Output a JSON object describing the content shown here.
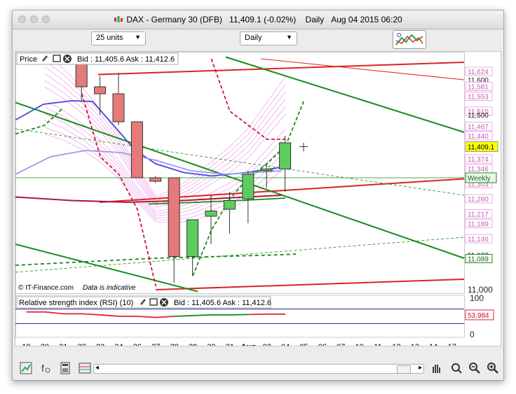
{
  "window": {
    "title": "DAX - Germany 30 (DFB)",
    "last": "11,409.1 (-0.02%)",
    "period": "Daily",
    "datetime": "Aug 04 2015 06:20"
  },
  "toolbar": {
    "units_select": "25 units",
    "timeframe_select": "Daily"
  },
  "price_panel": {
    "label": "Price",
    "bid_ask": "Bid : 11,405.6  Ask : 11,412.6",
    "watermark": "© IT-Finance.com",
    "disclaimer": "Data is indicative",
    "current_price": "11,409.1",
    "weekly_tag": "Weekly",
    "axis_labels": [
      "11,624",
      "11,600",
      "11,581",
      "11,553",
      "11,510",
      "11,500",
      "11,467",
      "11,440",
      "11,374",
      "11,346",
      "11,303",
      "11,260",
      "11,217",
      "11,189",
      "11,146",
      "11,100",
      "11,089",
      "11,000"
    ],
    "green_axis_label": "11,089"
  },
  "rsi_panel": {
    "label": "Relative strength index (RSI) (10)",
    "bid_ask": "Bid : 11,405.6  Ask : 11,412.6",
    "axis_top": "100",
    "axis_bottom": "0",
    "value": "53.984"
  },
  "xaxis": {
    "labels": [
      "19",
      "20",
      "21",
      "22",
      "23",
      "24",
      "26",
      "27",
      "28",
      "29",
      "30",
      "31",
      "Aug",
      "03",
      "04",
      "05",
      "06",
      "07",
      "10",
      "11",
      "12",
      "13",
      "14",
      "17"
    ]
  },
  "chart_data": {
    "type": "candlestick",
    "instrument": "DAX - Germany 30 (DFB)",
    "dates": [
      "21",
      "22",
      "23",
      "24",
      "26",
      "27",
      "28",
      "29",
      "30",
      "31",
      "Aug",
      "03"
    ],
    "ohlc": [
      {
        "date": "21",
        "open": 11660,
        "high": 11660,
        "low": 11540,
        "close": 11580
      },
      {
        "date": "22",
        "open": 11580,
        "high": 11610,
        "low": 11500,
        "close": 11560
      },
      {
        "date": "23",
        "open": 11560,
        "high": 11620,
        "low": 11470,
        "close": 11480
      },
      {
        "date": "24",
        "open": 11480,
        "high": 11480,
        "low": 11320,
        "close": 11320
      },
      {
        "date": "26",
        "open": 11320,
        "high": 11325,
        "low": 11305,
        "close": 11310
      },
      {
        "date": "27",
        "open": 11320,
        "high": 11320,
        "low": 11020,
        "close": 11095
      },
      {
        "date": "28",
        "open": 11095,
        "high": 11200,
        "low": 11040,
        "close": 11200
      },
      {
        "date": "29",
        "open": 11210,
        "high": 11270,
        "low": 11130,
        "close": 11225
      },
      {
        "date": "30",
        "open": 11230,
        "high": 11280,
        "low": 11160,
        "close": 11255
      },
      {
        "date": "31",
        "open": 11260,
        "high": 11340,
        "low": 11190,
        "close": 11330
      },
      {
        "date": "Aug",
        "open": 11340,
        "high": 11360,
        "low": 11290,
        "close": 11345
      },
      {
        "date": "03",
        "open": 11345,
        "high": 11440,
        "low": 11280,
        "close": 11420
      }
    ],
    "last_value": 11409.1,
    "rsi_last": 53.984,
    "rsi_range": [
      0,
      100
    ]
  }
}
